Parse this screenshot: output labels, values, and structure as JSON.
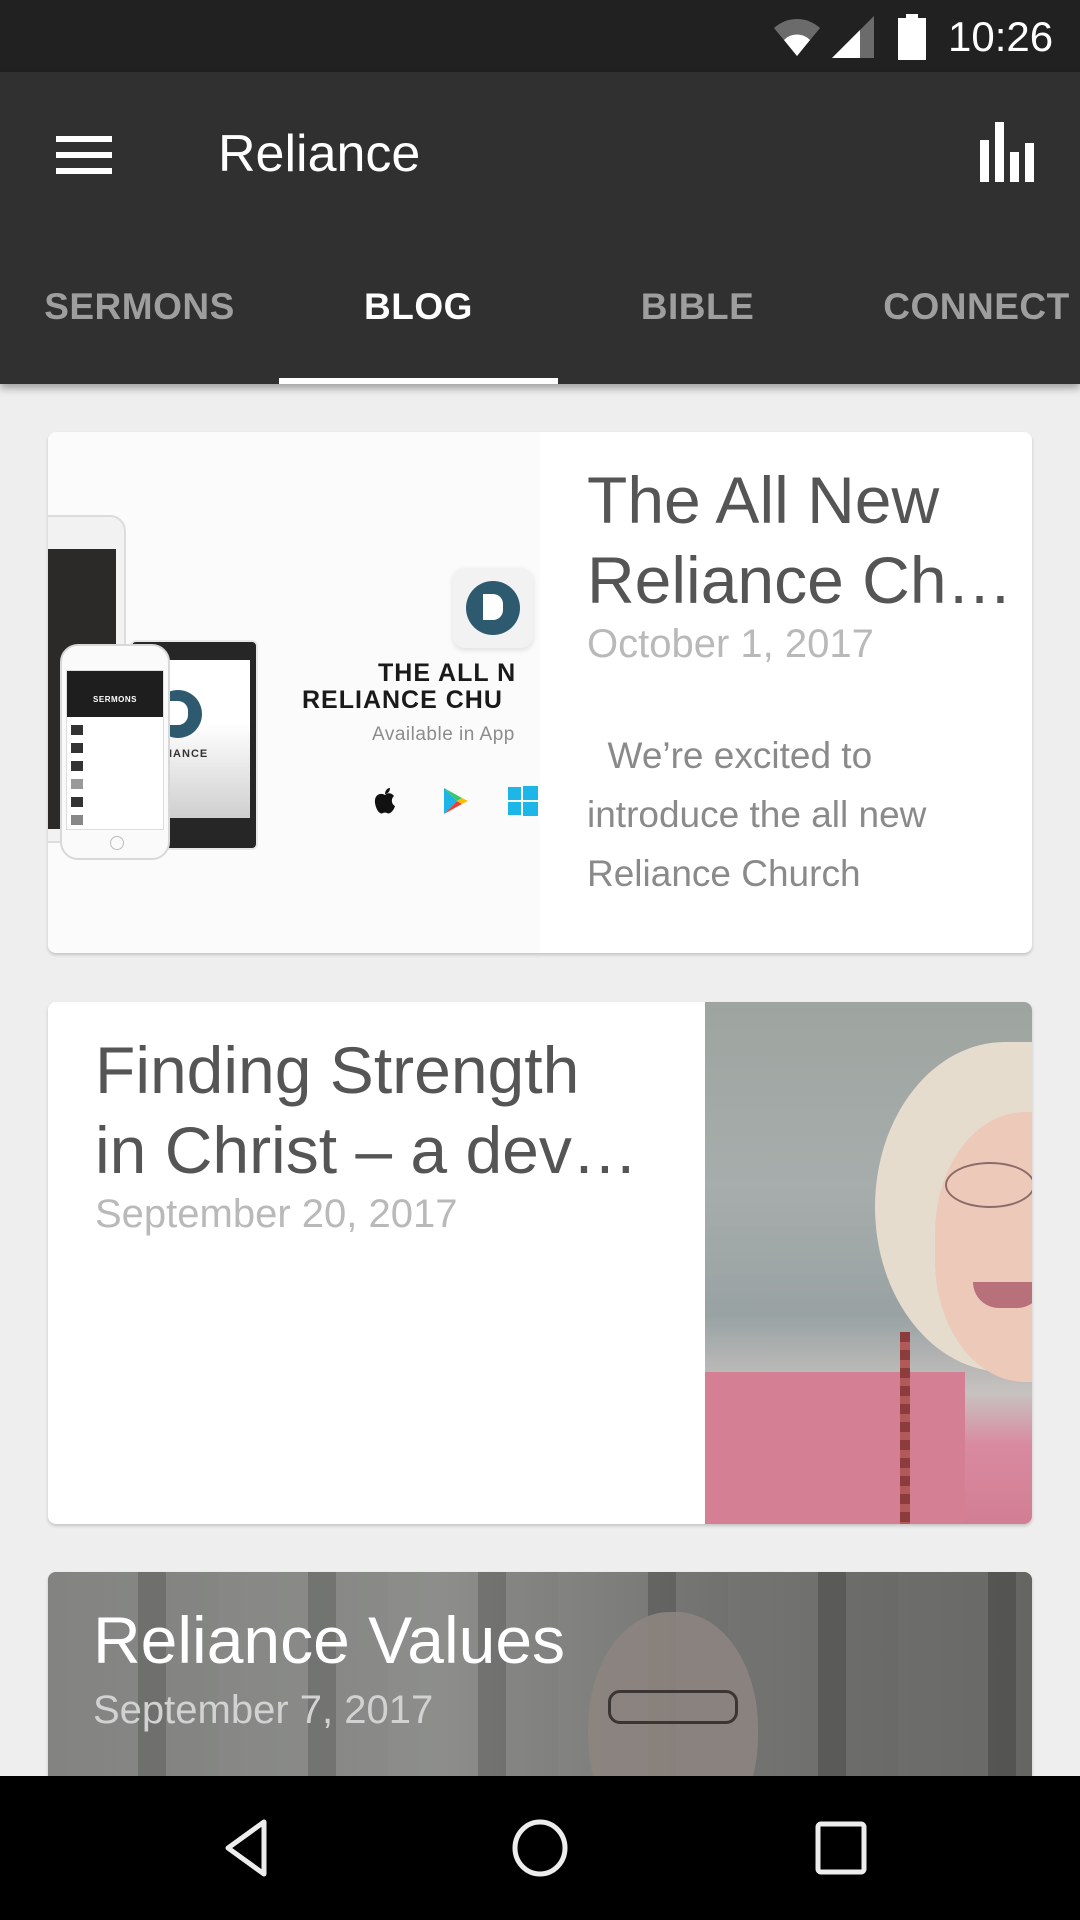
{
  "status_bar": {
    "time": "10:26",
    "icons": [
      "wifi-icon",
      "cell-signal-icon",
      "battery-icon"
    ]
  },
  "app_bar": {
    "title": "Reliance",
    "left_icon": "hamburger-menu-icon",
    "right_icon": "bar-chart-icon"
  },
  "tabs": [
    {
      "label": "SERMONS",
      "active": false
    },
    {
      "label": "BLOG",
      "active": true
    },
    {
      "label": "BIBLE",
      "active": false
    },
    {
      "label": "CONNECT",
      "active": false
    }
  ],
  "posts": [
    {
      "title": "The All New Reliance Ch…",
      "title_lines": [
        "The All New",
        "Reliance Ch…"
      ],
      "date": "October 1, 2017",
      "excerpt_lines": [
        "  We’re excited to",
        "introduce the all new",
        "Reliance Church"
      ],
      "image": {
        "kind": "app-promo",
        "headline_line1": "THE ALL N",
        "headline_line2": "RELIANCE CHU",
        "subline": "Available in App",
        "phone_header": "SERMONS",
        "phone_brand": "RELIANCE",
        "store_icons": [
          "apple-icon",
          "google-play-icon",
          "windows-icon"
        ]
      }
    },
    {
      "title_lines": [
        "Finding Strength",
        "in Christ – a dev…"
      ],
      "date": "September 20, 2017",
      "image": {
        "kind": "photo-woman"
      }
    },
    {
      "title_lines": [
        "Reliance Values"
      ],
      "date": "September 7, 2017",
      "image": {
        "kind": "photo-man-background"
      }
    }
  ],
  "nav_bar": {
    "buttons": [
      "back",
      "home",
      "recents"
    ]
  },
  "colors": {
    "status_bar": "#212121",
    "app_bar": "#303030",
    "tab_active": "#ffffff",
    "tab_inactive": "#9e9e9e",
    "background": "#eeeeee",
    "card_title": "#555555",
    "card_date": "#b9b9b9",
    "card_excerpt": "#8a8a8a",
    "brand_logo": "#2e5a70"
  }
}
